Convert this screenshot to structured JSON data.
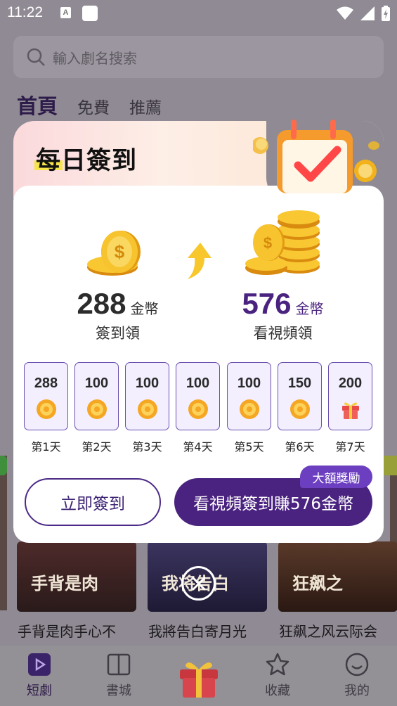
{
  "status": {
    "time": "11:22",
    "a_icon": "A"
  },
  "search": {
    "placeholder": "輸入劇名搜索"
  },
  "top_tabs": [
    "首頁",
    "免費",
    "推薦"
  ],
  "background_items": [
    {
      "title": "手背是肉手心不",
      "poster": "手背是肉"
    },
    {
      "title": "我將告白寄月光",
      "poster": "我将告白"
    },
    {
      "title": "狂飙之风云际会",
      "poster": "狂飙之"
    }
  ],
  "bottom_nav": [
    {
      "label": "短劇",
      "icon": "play-icon"
    },
    {
      "label": "書城",
      "icon": "book-icon"
    },
    {
      "label": "收藏",
      "icon": "star-icon"
    },
    {
      "label": "我的",
      "icon": "profile-icon"
    }
  ],
  "modal": {
    "title": "每日簽到",
    "left_reward": {
      "amount": "288",
      "unit": "金幣",
      "caption": "簽到領"
    },
    "right_reward": {
      "amount": "576",
      "unit": "金幣",
      "caption": "看視頻領"
    },
    "days": [
      {
        "value": "288",
        "label": "第1天",
        "icon": "coin-icon"
      },
      {
        "value": "100",
        "label": "第2天",
        "icon": "coin-icon"
      },
      {
        "value": "100",
        "label": "第3天",
        "icon": "coin-icon"
      },
      {
        "value": "100",
        "label": "第4天",
        "icon": "coin-icon"
      },
      {
        "value": "100",
        "label": "第5天",
        "icon": "coin-icon"
      },
      {
        "value": "150",
        "label": "第6天",
        "icon": "coin-icon"
      },
      {
        "value": "200",
        "label": "第7天",
        "icon": "gift-icon"
      }
    ],
    "btn_now": "立即簽到",
    "btn_video": "看視頻簽到賺576金幣",
    "badge": "大額獎勵"
  },
  "colors": {
    "accent": "#4a2280",
    "accent_light": "#6c3fc0",
    "coin": "#f2b21b",
    "overlay": "#8f8a93"
  }
}
